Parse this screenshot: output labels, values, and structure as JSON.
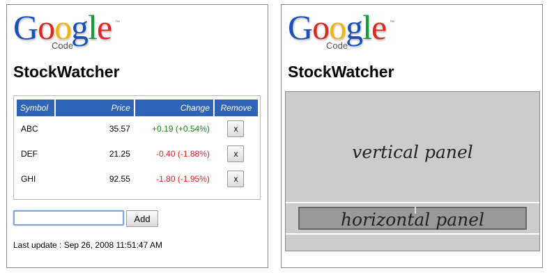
{
  "logo": {
    "letters": [
      "G",
      "o",
      "o",
      "g",
      "l",
      "e"
    ],
    "letter_colors": [
      "#1a50b7",
      "#d92920",
      "#f2b50f",
      "#1a50b7",
      "#179a3a",
      "#d92920"
    ],
    "trademark": "™",
    "sub": "Code"
  },
  "left": {
    "app_title": "StockWatcher",
    "table": {
      "headers": {
        "symbol": "Symbol",
        "price": "Price",
        "change": "Change",
        "remove": "Remove"
      },
      "rows": [
        {
          "symbol": "ABC",
          "price": "35.57",
          "change": "+0.19 (+0.54%)",
          "trend": "up",
          "remove": "x"
        },
        {
          "symbol": "DEF",
          "price": "21.25",
          "change": "-0.40 (-1.88%)",
          "trend": "down",
          "remove": "x"
        },
        {
          "symbol": "GHI",
          "price": "92.55",
          "change": "-1.80 (-1.95%)",
          "trend": "down",
          "remove": "x"
        }
      ]
    },
    "input": {
      "value": "",
      "placeholder": ""
    },
    "add_button": "Add",
    "last_update": "Last update : Sep 26, 2008 11:51:47 AM"
  },
  "right": {
    "app_title": "StockWatcher",
    "vertical_panel_label": "vertical panel",
    "horizontal_panel_label": "horizontal panel"
  },
  "colors": {
    "header_blue": "#2e63b6",
    "positive": "#118811",
    "negative": "#dd2222",
    "panel_grey": "#cccccc",
    "inner_panel_grey": "#999999"
  }
}
